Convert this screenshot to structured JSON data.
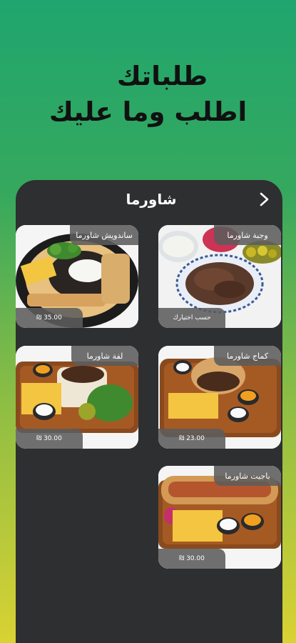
{
  "headline": {
    "line1": "طلباتك",
    "line2": "اطلب وما عليك"
  },
  "screen": {
    "title": "شاورما"
  },
  "items": [
    {
      "name": "وجبة شاورما",
      "price": "حسب اختيارك"
    },
    {
      "name": "ساندويش شاورما",
      "price": "35.00 ₪"
    },
    {
      "name": "كماج شاورما",
      "price": "23.00 ₪"
    },
    {
      "name": "لفة شاورما",
      "price": "30.00 ₪"
    },
    {
      "name": "باجيت شاورما",
      "price": "30.00 ₪"
    }
  ]
}
